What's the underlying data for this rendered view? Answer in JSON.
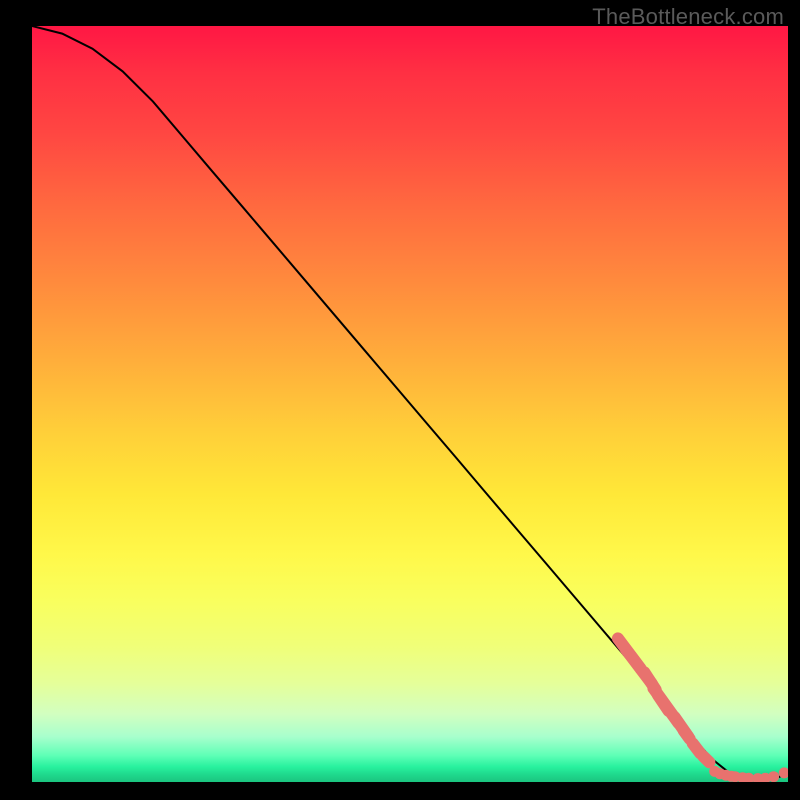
{
  "watermark": "TheBottleneck.com",
  "colors": {
    "line": "#000000",
    "markers": "#e8726e",
    "gradient_top": "#ff1744",
    "gradient_bottom": "#1bc47f"
  },
  "chart_data": {
    "type": "line",
    "title": "",
    "xlabel": "",
    "ylabel": "",
    "xlim": [
      0,
      100
    ],
    "ylim": [
      0,
      100
    ],
    "grid": false,
    "legend": false,
    "x": [
      0,
      4,
      8,
      12,
      16,
      20,
      24,
      28,
      32,
      36,
      40,
      44,
      48,
      52,
      56,
      60,
      64,
      68,
      72,
      76,
      80,
      82,
      84,
      86,
      88,
      90,
      92,
      94,
      96,
      98,
      100
    ],
    "y": [
      100,
      99,
      97,
      94,
      90,
      85.3,
      80.6,
      75.9,
      71.2,
      66.5,
      61.8,
      57.1,
      52.4,
      47.7,
      43,
      38.3,
      33.6,
      28.9,
      24.2,
      19.5,
      14.8,
      12.4,
      10,
      7.6,
      5.2,
      3,
      1.4,
      0.6,
      0.2,
      0.3,
      1.2
    ],
    "marker_segments": [
      {
        "x1": 77.5,
        "y1": 19.0,
        "x2": 80.5,
        "y2": 15.0
      },
      {
        "x1": 78.5,
        "y1": 17.6,
        "x2": 82.0,
        "y2": 13.0
      },
      {
        "x1": 81.0,
        "y1": 14.5,
        "x2": 82.5,
        "y2": 12.2
      },
      {
        "x1": 82.8,
        "y1": 11.5,
        "x2": 84.2,
        "y2": 9.4
      },
      {
        "x1": 82.2,
        "y1": 12.4,
        "x2": 85.5,
        "y2": 7.8
      },
      {
        "x1": 85.0,
        "y1": 8.6,
        "x2": 86.8,
        "y2": 6.0
      },
      {
        "x1": 86.2,
        "y1": 6.8,
        "x2": 87.0,
        "y2": 5.7
      },
      {
        "x1": 87.4,
        "y1": 5.1,
        "x2": 88.4,
        "y2": 3.8
      },
      {
        "x1": 88.8,
        "y1": 3.4,
        "x2": 89.6,
        "y2": 2.6
      }
    ],
    "flat_marker_dots": [
      {
        "x": 90.3,
        "y": 1.4
      },
      {
        "x": 91.0,
        "y": 1.1
      },
      {
        "x": 91.8,
        "y": 0.9
      },
      {
        "x": 92.5,
        "y": 0.75
      },
      {
        "x": 93.0,
        "y": 0.7
      },
      {
        "x": 94.0,
        "y": 0.55
      },
      {
        "x": 94.8,
        "y": 0.5
      },
      {
        "x": 96.0,
        "y": 0.45
      },
      {
        "x": 97.0,
        "y": 0.5
      },
      {
        "x": 98.1,
        "y": 0.7
      },
      {
        "x": 99.5,
        "y": 1.2
      }
    ]
  }
}
